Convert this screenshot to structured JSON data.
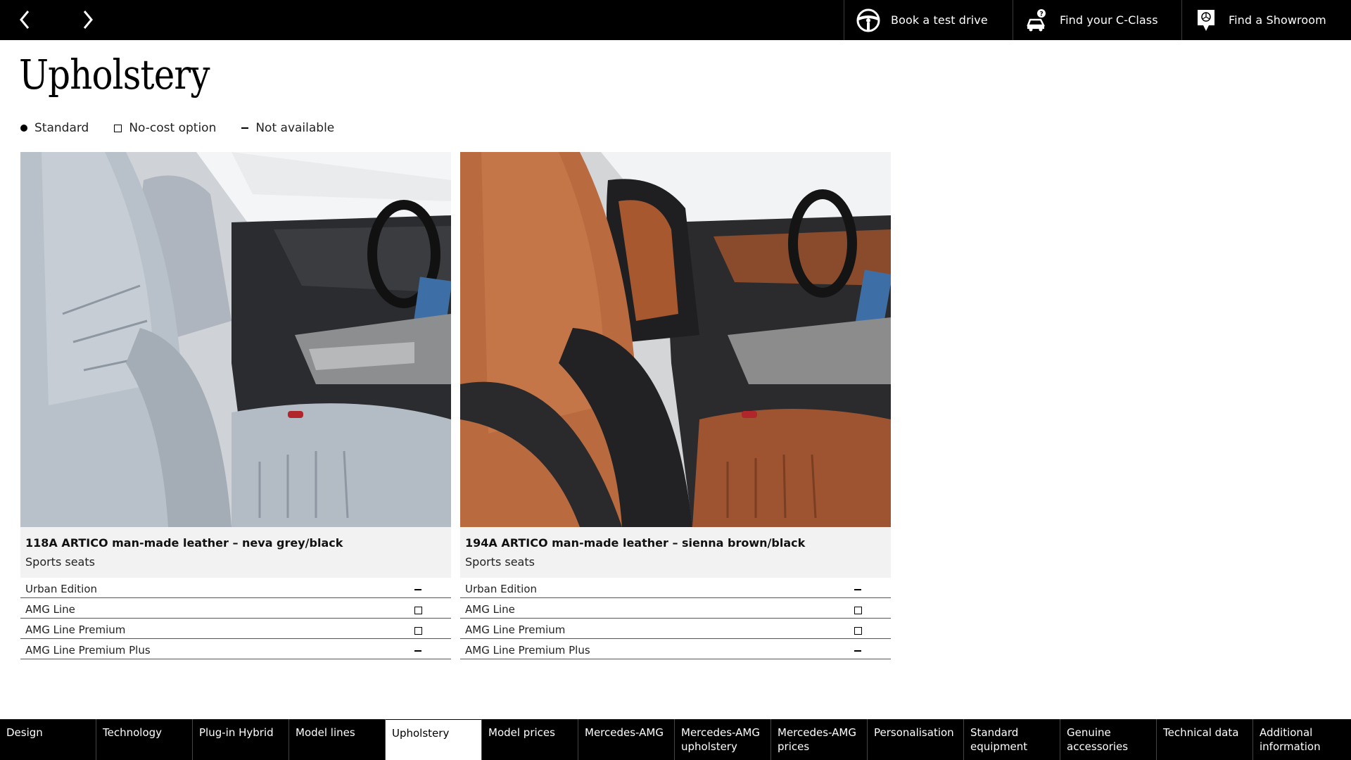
{
  "topbar": {
    "prev_icon": "chevron-left-icon",
    "next_icon": "chevron-right-icon",
    "actions": [
      {
        "label": "Book a test drive",
        "icon": "steering-wheel-icon"
      },
      {
        "label": "Find your C-Class",
        "icon": "car-search-icon"
      },
      {
        "label": "Find a Showroom",
        "icon": "location-pin-icon"
      }
    ]
  },
  "page": {
    "title": "Upholstery"
  },
  "legend": {
    "standard": "Standard",
    "no_cost": "No-cost option",
    "not_available": "Not available"
  },
  "cards": [
    {
      "code": "118A  ARTICO man-made leather – neva grey/black",
      "sub": "Sports seats",
      "rows": [
        {
          "label": "Urban Edition",
          "status": "not-available"
        },
        {
          "label": "AMG Line",
          "status": "no-cost"
        },
        {
          "label": "AMG Line Premium",
          "status": "no-cost"
        },
        {
          "label": "AMG Line Premium Plus",
          "status": "not-available"
        }
      ]
    },
    {
      "code": "194A  ARTICO man-made leather – sienna brown/black",
      "sub": "Sports seats",
      "rows": [
        {
          "label": "Urban Edition",
          "status": "not-available"
        },
        {
          "label": "AMG Line",
          "status": "no-cost"
        },
        {
          "label": "AMG Line Premium",
          "status": "no-cost"
        },
        {
          "label": "AMG Line Premium Plus",
          "status": "not-available"
        }
      ]
    }
  ],
  "bottom_nav": {
    "tabs": [
      {
        "label": "Design"
      },
      {
        "label": "Technology"
      },
      {
        "label": "Plug-in Hybrid"
      },
      {
        "label": "Model lines"
      },
      {
        "label": "Upholstery",
        "active": true
      },
      {
        "label": "Model prices"
      },
      {
        "label": "Mercedes-AMG"
      },
      {
        "label": "Mercedes-AMG upholstery"
      },
      {
        "label": "Mercedes-AMG prices"
      },
      {
        "label": "Personalisation"
      },
      {
        "label": "Standard equipment"
      },
      {
        "label": "Genuine accessories"
      },
      {
        "label": "Technical data"
      },
      {
        "label": "Additional information"
      }
    ]
  },
  "colors": {
    "bar": "#000000",
    "caption_bg": "#f2f2f2",
    "seat_grey": "#b9c0c8",
    "seat_brown": "#b5643a"
  }
}
